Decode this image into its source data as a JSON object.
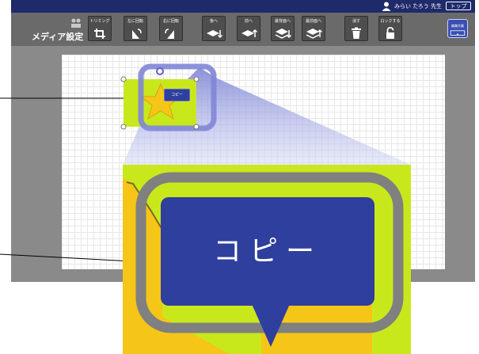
{
  "header": {
    "user_name": "みらい たろう 先生",
    "top_button_label": "トップ"
  },
  "toolbar": {
    "title": "メディア設定",
    "buttons": [
      {
        "label": "トリミング",
        "icon": "crop-icon"
      },
      {
        "label": "左に回転",
        "icon": "rotate-left-icon"
      },
      {
        "label": "右に回転",
        "icon": "rotate-right-icon"
      },
      {
        "label": "後へ",
        "icon": "send-backward-icon"
      },
      {
        "label": "前へ",
        "icon": "bring-forward-icon"
      },
      {
        "label": "最背面へ",
        "icon": "send-to-back-icon"
      },
      {
        "label": "最前面へ",
        "icon": "bring-to-front-icon"
      },
      {
        "label": "消す",
        "icon": "trash-icon"
      },
      {
        "label": "ロックする",
        "icon": "lock-icon"
      }
    ],
    "edit_button_label": "編集作業",
    "edit_button_icon": "layout-edit-icon"
  },
  "canvas": {
    "selected_object": {
      "type": "star-with-speech-bubble",
      "bubble_text": "コピー"
    }
  },
  "zoom": {
    "bubble_text": "コピー"
  },
  "colors": {
    "header_bg": "#1e2a6a",
    "toolbar_bg": "#6a6a6a",
    "workspace_bg": "#8a8a8a",
    "lime": "#c9e81c",
    "star": "#f5c518",
    "bubble": "#2f3f9e",
    "highlight_ring": "#7f86d6"
  }
}
